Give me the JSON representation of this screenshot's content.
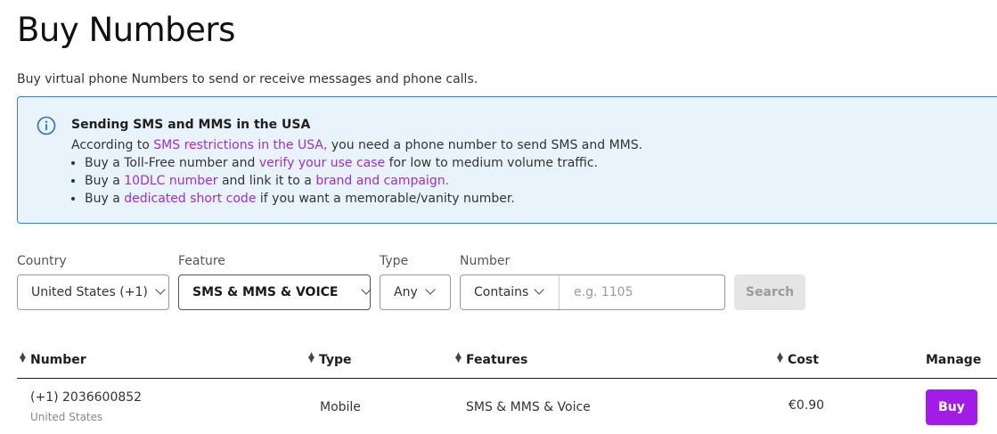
{
  "page": {
    "title": "Buy Numbers",
    "subtitle": "Buy virtual phone Numbers to send or receive messages and phone calls."
  },
  "banner": {
    "icon": "info-icon",
    "title": "Sending SMS and MMS in the USA",
    "intro_prefix": "According to ",
    "intro_link": "SMS restrictions in the USA,",
    "intro_suffix": " you need a phone number to send SMS and MMS.",
    "bullets": [
      {
        "prefix": "Buy a Toll-Free number and ",
        "link": "verify your use case",
        "suffix": " for low to medium volume traffic."
      },
      {
        "prefix": "Buy a ",
        "link": "10DLC number",
        "middle": " and link it to a ",
        "link2": "brand and campaign.",
        "suffix": ""
      },
      {
        "prefix": "Buy a ",
        "link": "dedicated short code",
        "suffix": " if you want a memorable/vanity number."
      }
    ],
    "link_color": "#9b2fd6",
    "background": "#e8f3fb",
    "border": "#3b7bd4"
  },
  "filters": {
    "country": {
      "label": "Country",
      "value": "United States (+1)"
    },
    "feature": {
      "label": "Feature",
      "value": "SMS & MMS & VOICE"
    },
    "type": {
      "label": "Type",
      "value": "Any"
    },
    "number": {
      "label": "Number",
      "match": "Contains",
      "placeholder": "e.g. 1105"
    },
    "search_label": "Search"
  },
  "table": {
    "columns": [
      "Number",
      "Type",
      "Features",
      "Cost",
      "Manage"
    ],
    "rows": [
      {
        "number": "(+1) 2036600852",
        "country": "United States",
        "type": "Mobile",
        "features": "SMS & MMS & Voice",
        "cost": "€0.90",
        "action": "Buy"
      }
    ]
  },
  "colors": {
    "accent": "#a21ce8"
  }
}
